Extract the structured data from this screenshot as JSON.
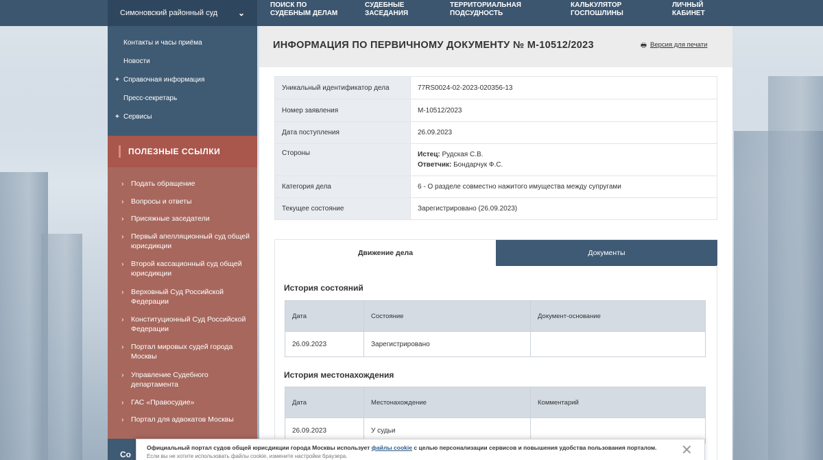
{
  "header": {
    "court_select": "Симоновский районный суд",
    "nav": [
      {
        "line1": "Поиск по",
        "line2": "судебным делам"
      },
      {
        "line1": "Судебные",
        "line2": "заседания"
      },
      {
        "line1": "Территориальная",
        "line2": "подсудность"
      },
      {
        "line1": "Калькулятор",
        "line2": "госпошлины"
      },
      {
        "line1": "Личный",
        "line2": "кабинет"
      }
    ]
  },
  "sidebar": {
    "top_links": [
      {
        "label": "Контакты и часы приёма",
        "plus": ""
      },
      {
        "label": "Новости",
        "plus": ""
      },
      {
        "label": "Справочная информация",
        "plus": "+"
      },
      {
        "label": "Пресс-секретарь",
        "plus": ""
      },
      {
        "label": "Сервисы",
        "plus": "+"
      }
    ],
    "useful_title": "Полезные ссылки",
    "useful_links": [
      "Подать обращение",
      "Вопросы и ответы",
      "Присяжные заседатели",
      "Первый апелляционный суд общей юрисдикции",
      "Второй кассационный суд общей юрисдикции",
      "Верховный Суд Российской Федерации",
      "Конституционный Суд Российской Федерации",
      "Портал мировых судей города Москвы",
      "Управление Судебного департамента",
      "ГАС «Правосудие»",
      "Портал для адвокатов Москвы"
    ],
    "bottom_title": "Со"
  },
  "main": {
    "title": "Информация по первичному документу № М-10512/2023",
    "print_label": "Версия для печати",
    "info_rows": [
      {
        "label": "Уникальный идентификатор дела",
        "value": "77RS0024-02-2023-020356-13"
      },
      {
        "label": "Номер заявления",
        "value": "М-10512/2023"
      },
      {
        "label": "Дата поступления",
        "value": "26.09.2023"
      },
      {
        "label": "Стороны",
        "plaintiff_label": "Истец:",
        "plaintiff": "Рудская С.В.",
        "defendant_label": "Ответчик:",
        "defendant": "Бондарчук Ф.С."
      },
      {
        "label": "Категория дела",
        "value": "6 - О разделе совместно нажитого имущества между супругами"
      },
      {
        "label": "Текущее состояние",
        "value": "Зарегистрировано (26.09.2023)"
      }
    ],
    "tabs": [
      "Движение дела",
      "Документы"
    ],
    "history_states": {
      "title": "История состояний",
      "headers": [
        "Дата",
        "Состояние",
        "Документ-основание"
      ],
      "rows": [
        [
          "26.09.2023",
          "Зарегистрировано",
          ""
        ]
      ]
    },
    "history_location": {
      "title": "История местонахождения",
      "headers": [
        "Дата",
        "Местонахождение",
        "Комментарий"
      ],
      "rows": [
        [
          "26.09.2023",
          "У судьи",
          ""
        ]
      ]
    }
  },
  "cookie": {
    "text_before": "Официальный портал судов общей юрисдикции города Москвы использует ",
    "link": "файлы cookie",
    "text_after": " с целью персонализации сервисов и повышения удобства пользования порталом.",
    "line2": "Если вы не хотите использовать файлы cookie, измените настройки браузера."
  },
  "icons": {
    "chevron": "chevron-down-icon",
    "print": "printer-icon",
    "close": "close-icon"
  }
}
